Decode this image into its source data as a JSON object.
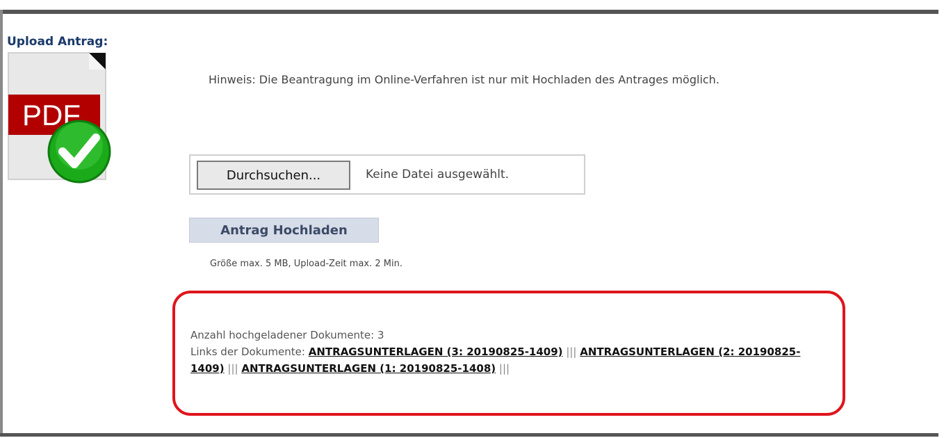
{
  "section": {
    "label": "Upload Antrag:"
  },
  "pdf_icon": {
    "text": "PDF",
    "status_icon": "check-circle-icon",
    "banner_color": "#b20000",
    "check_color": "#1aaa1a"
  },
  "hint": "Hinweis: Die Beantragung im Online-Verfahren ist nur mit Hochladen des Antrages möglich.",
  "file_input": {
    "browse_label": "Durchsuchen...",
    "status": "Keine Datei ausgewählt."
  },
  "upload_button": {
    "label": "Antrag Hochladen"
  },
  "limits": "Größe max. 5 MB, Upload-Zeit max. 2 Min.",
  "documents": {
    "count_label": "Anzahl hochgeladener Dokumente:",
    "count": "3",
    "links_label": "Links der Dokumente:",
    "separator": "|||",
    "links": [
      "ANTRAGSUNTERLAGEN (3: 20190825-1409)",
      "ANTRAGSUNTERLAGEN (2: 20190825-1409)",
      "ANTRAGSUNTERLAGEN (1: 20190825-1408)"
    ]
  },
  "colors": {
    "frame": "#555555",
    "highlight": "#e0141c",
    "upload_button_bg": "#d6dce8"
  }
}
